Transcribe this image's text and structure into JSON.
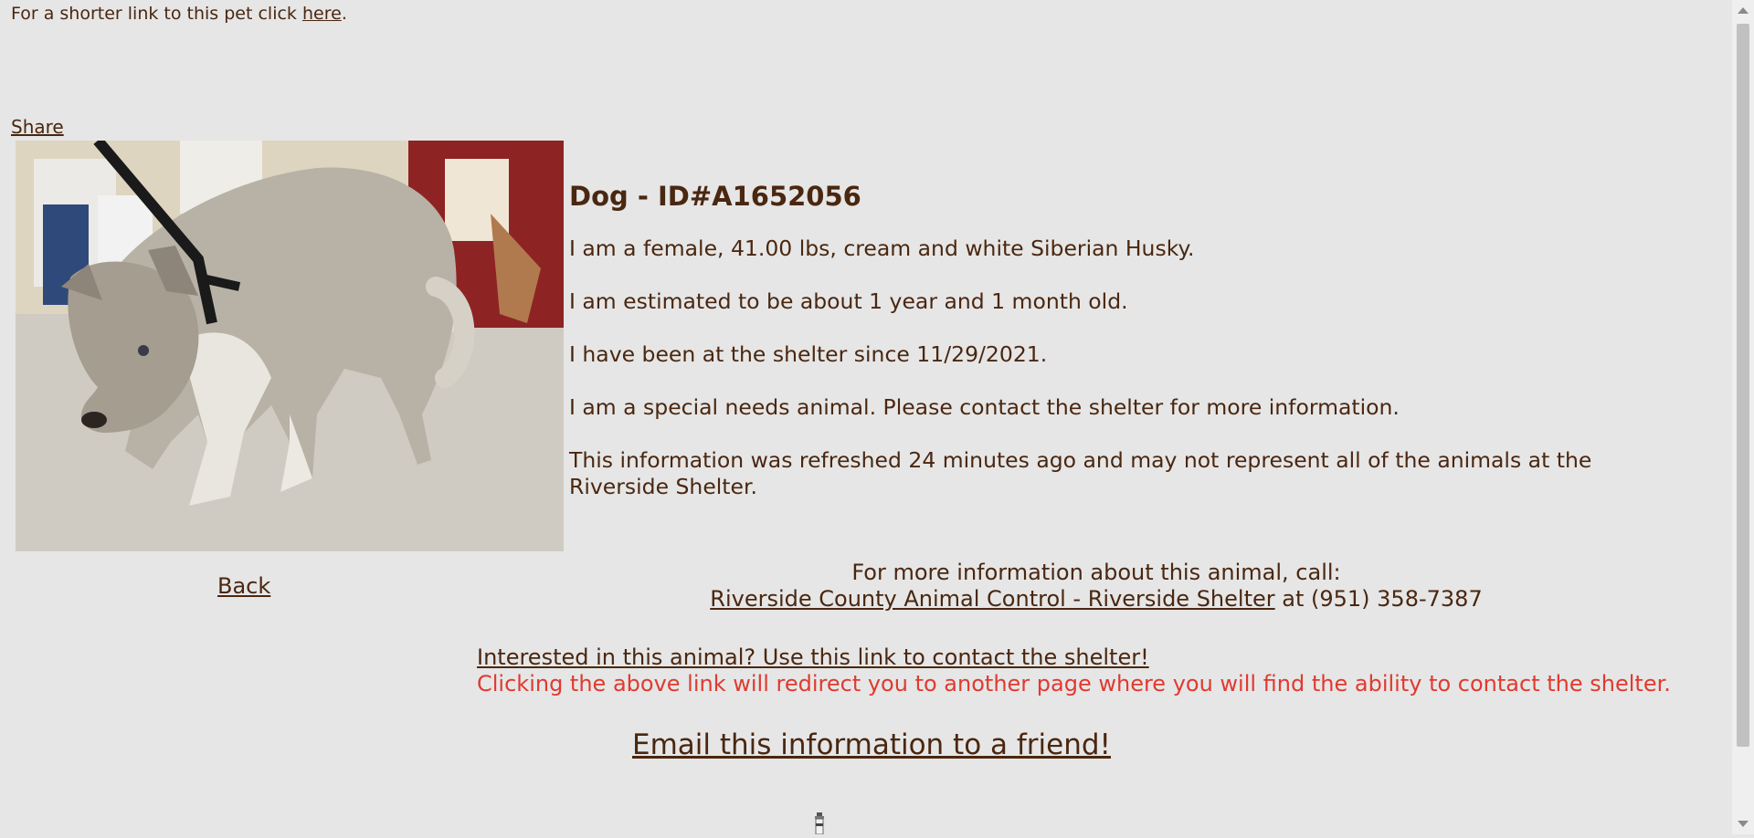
{
  "header": {
    "short_link_prefix": "For a shorter link to this pet click ",
    "short_link_text": "here",
    "short_link_suffix": ".",
    "share_label": "Share"
  },
  "pet": {
    "photo_icon": "dog-photo",
    "title": "Dog - ID#A1652056",
    "description": "I am a female, 41.00 lbs, cream and white Siberian Husky.",
    "age": "I am estimated to be about 1 year and 1 month old.",
    "since": "I have been at the shelter since 11/29/2021.",
    "special_needs": "I am a special needs animal. Please contact the shelter for more information.",
    "refresh_note": "This information was refreshed 24 minutes ago and may not represent all of the animals at the Riverside Shelter."
  },
  "nav": {
    "back_label": "Back"
  },
  "contact": {
    "call_prompt": "For more information about this animal, call:",
    "shelter_link": "Riverside County Animal Control - Riverside Shelter",
    "phone_text": " at (951) 358-7387",
    "interested_link": "Interested in this animal? Use this link to contact the shelter!",
    "redirect_note": "Clicking the above link will redirect you to another page where you will find the ability to contact the shelter.",
    "email_link": "Email this information to a friend!"
  },
  "colors": {
    "background": "#e6e6e6",
    "text": "#4a2710",
    "warning": "#e03a2f"
  }
}
